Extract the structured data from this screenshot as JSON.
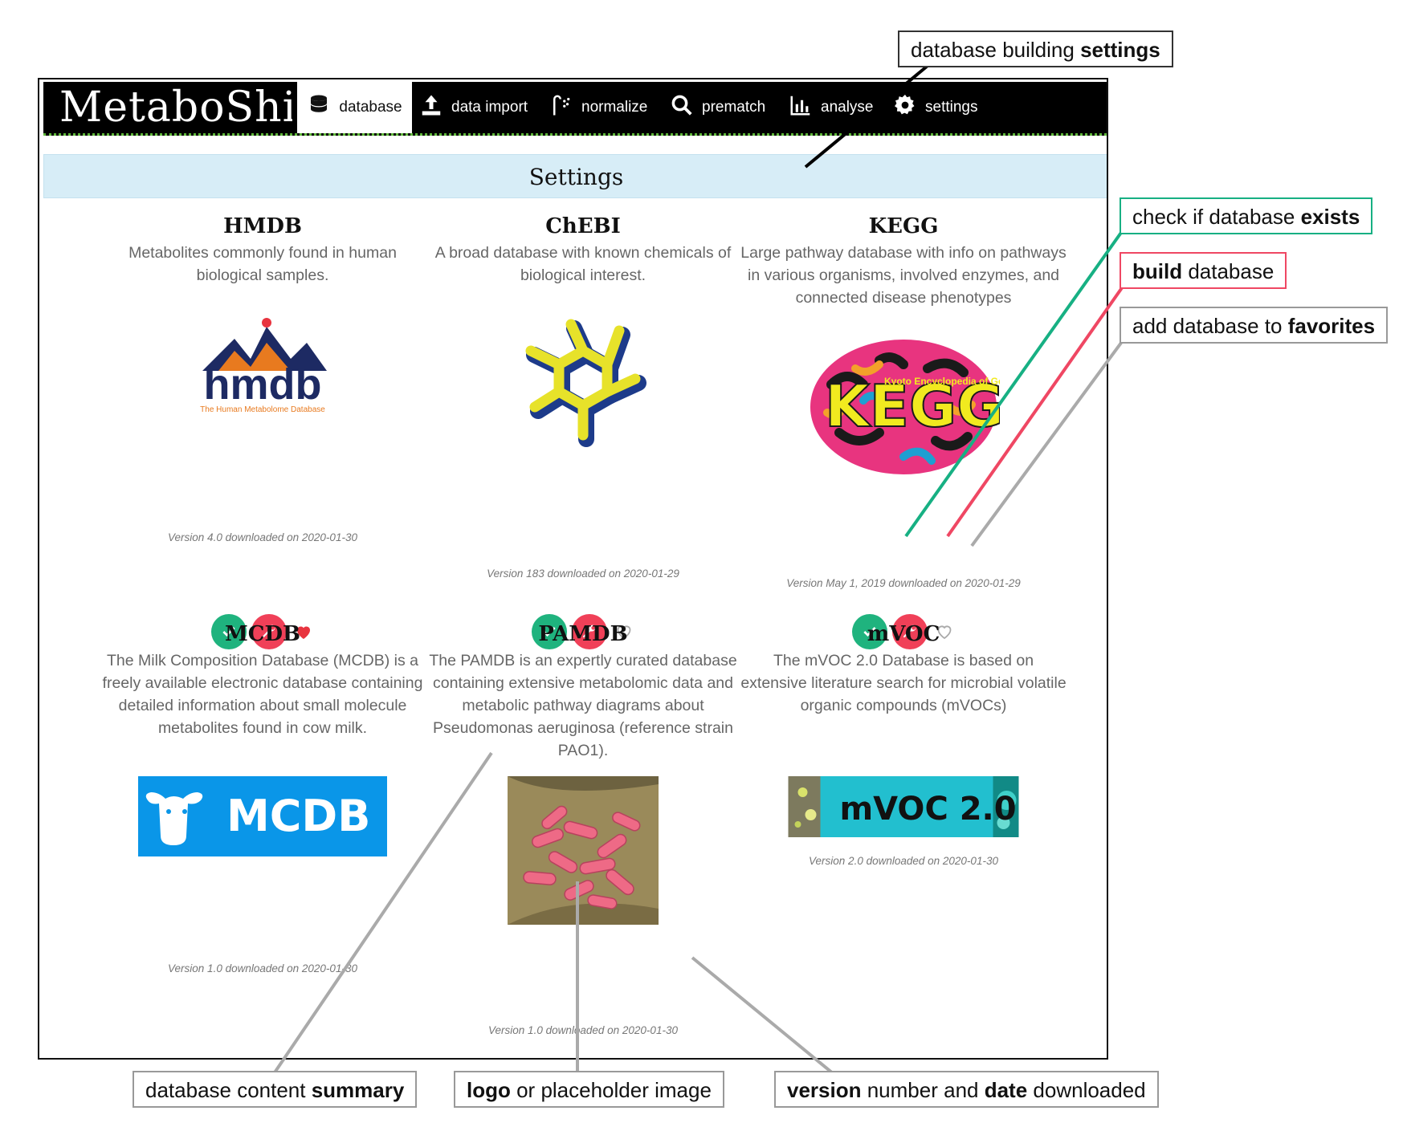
{
  "app": {
    "brand": "MetaboShiny"
  },
  "nav": [
    {
      "label": "database",
      "icon": "database-icon"
    },
    {
      "label": "data import",
      "icon": "upload-icon"
    },
    {
      "label": "normalize",
      "icon": "shower-icon"
    },
    {
      "label": "prematch",
      "icon": "search-icon"
    },
    {
      "label": "analyse",
      "icon": "chart-icon"
    },
    {
      "label": "settings",
      "icon": "gear-icon"
    }
  ],
  "settings_header": "Settings",
  "databases": [
    {
      "title": "HMDB",
      "description": "Metabolites commonly found in human biological samples.",
      "logo_text": "hmdb",
      "logo_subtext": "The Human Metabolome Database",
      "version": "Version 4.0 downloaded on 2020-01-30",
      "favorite": true
    },
    {
      "title": "ChEBI",
      "description": "A broad database with known chemicals of biological interest.",
      "version": "Version 183 downloaded on 2020-01-29",
      "favorite": false
    },
    {
      "title": "KEGG",
      "description": "Large pathway database with info on pathways in various organisms, involved enzymes, and connected disease phenotypes",
      "logo_text": "KEGG",
      "logo_subtext": "Kyoto Encyclopedia of Genes and Genomes",
      "version": "Version May 1, 2019 downloaded on 2020-01-29",
      "favorite": false
    },
    {
      "title": "MCDB",
      "description": "The Milk Composition Database (MCDB) is a freely available electronic database containing detailed information about small molecule metabolites found in cow milk.",
      "logo_text": "MCDB",
      "version": "Version 1.0 downloaded on 2020-01-30",
      "favorite": false
    },
    {
      "title": "PAMDB",
      "description": "The PAMDB is an expertly curated database containing extensive metabolomic data and metabolic pathway diagrams about Pseudomonas aeruginosa (reference strain PAO1).",
      "version": "Version 1.0 downloaded on 2020-01-30",
      "favorite": false
    },
    {
      "title": "mVOC",
      "description": "The mVOC 2.0 Database is based on extensive literature search for microbial volatile organic compounds (mVOCs)",
      "logo_text": "mVOC 2.0",
      "version": "Version 2.0 downloaded on 2020-01-30",
      "favorite": false
    }
  ],
  "callouts": {
    "settings": {
      "pre": "database building ",
      "bold": "settings",
      "post": ""
    },
    "exists": {
      "pre": "check if database ",
      "bold": "exists",
      "post": ""
    },
    "build": {
      "pre": "",
      "bold": "build",
      "post": " database"
    },
    "favorites": {
      "pre": "add database to ",
      "bold": "favorites",
      "post": ""
    },
    "summary": {
      "pre": "database content ",
      "bold": "summary",
      "post": ""
    },
    "logo": {
      "pre": "",
      "bold": "logo",
      "post": " or placeholder image"
    },
    "version": {
      "pre": "",
      "bold": "version",
      "bold2": "date",
      "mid": " number and ",
      "post": " downloaded"
    }
  },
  "colors": {
    "check": "#1fb37e",
    "build": "#f04058",
    "favorite": "#e8343f",
    "callout_exists": "#17b083",
    "callout_build": "#ef4763",
    "settings_bar": "#d7edf7"
  }
}
